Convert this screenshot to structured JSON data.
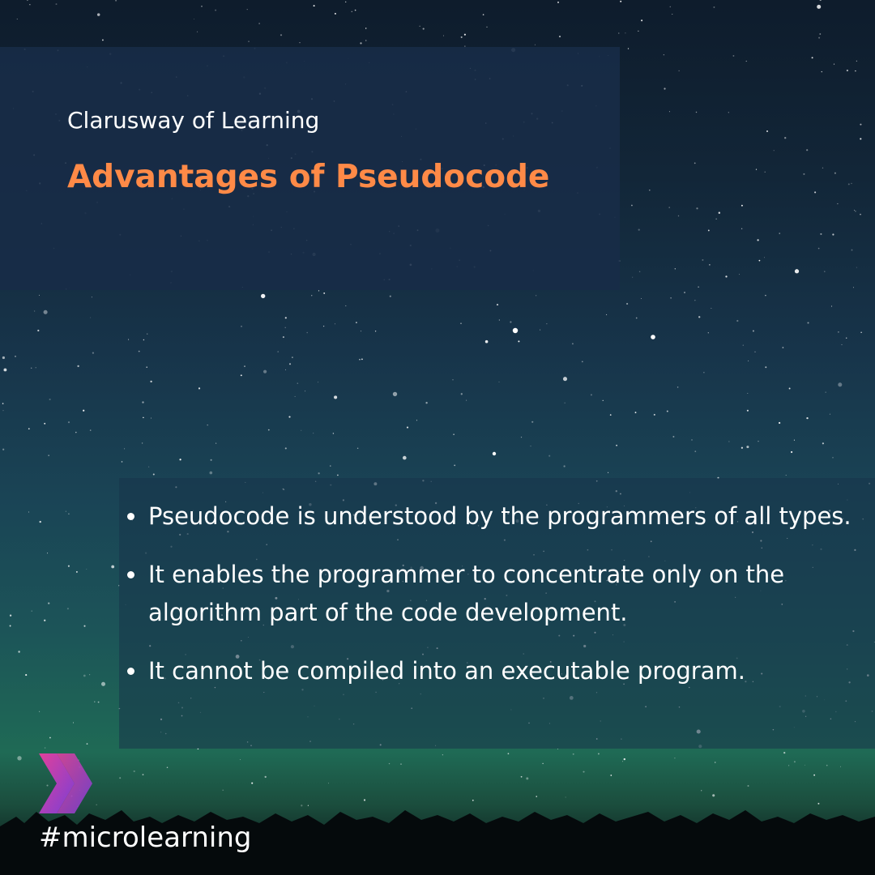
{
  "header": {
    "subtitle": "Clarusway of Learning",
    "title": "Advantages of Pseudocode"
  },
  "points": [
    "Pseudocode is understood by the programmers of all types.",
    "It enables the programmer to concentrate only on the algorithm part of the code development.",
    "It cannot be compiled into an executable program."
  ],
  "footer": {
    "hashtag": "#microlearning",
    "logo_icon": "double-chevron-icon"
  },
  "colors": {
    "title_accent": "#ff8a47",
    "logo_pink": "#e0409a",
    "logo_purple": "#7a3fd6"
  }
}
